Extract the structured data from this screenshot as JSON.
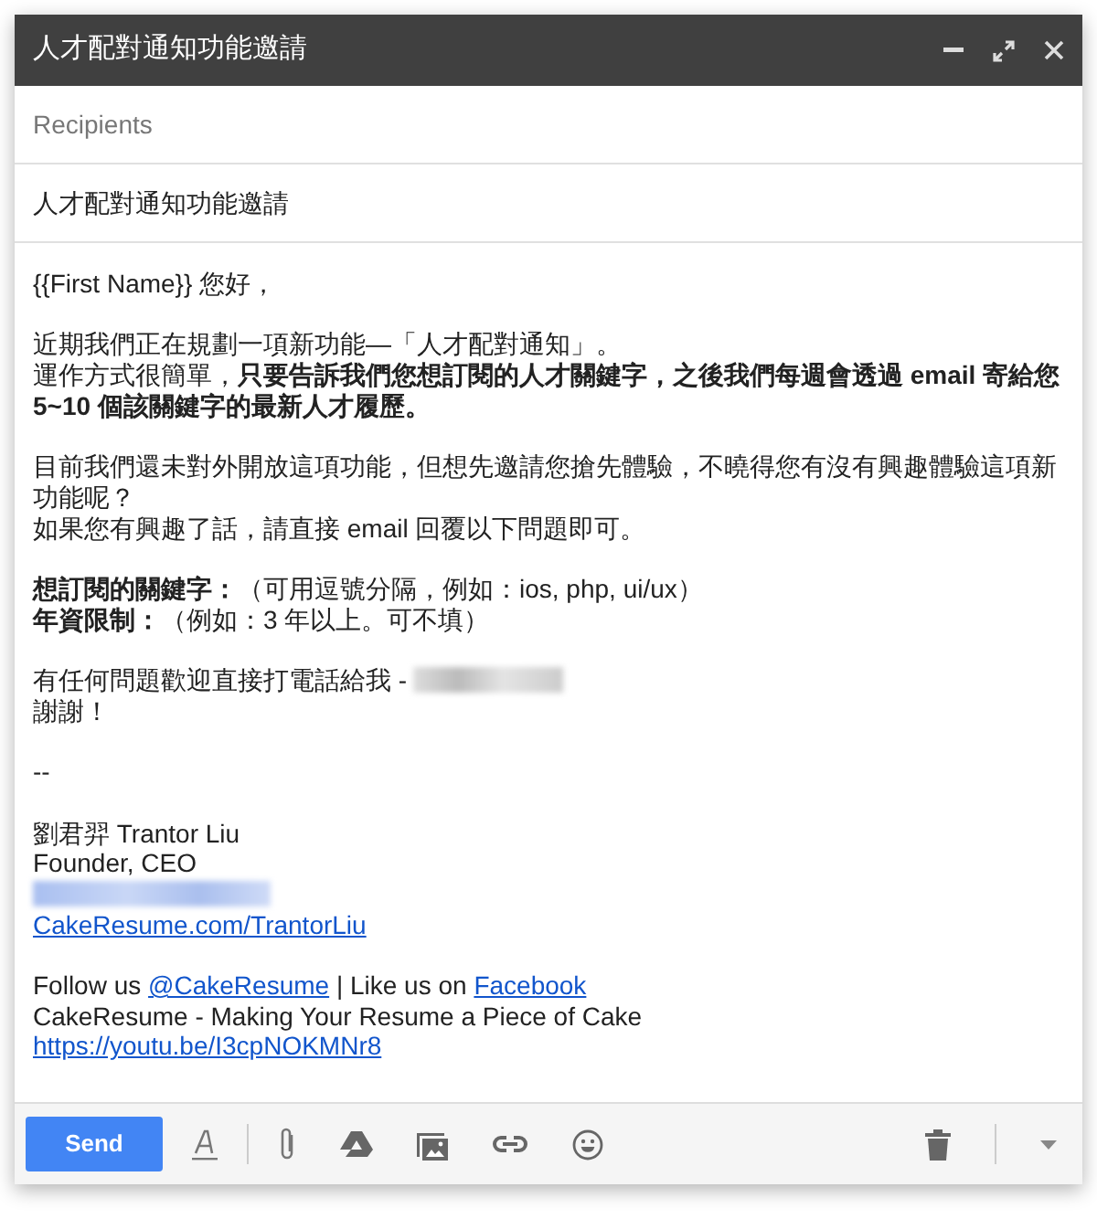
{
  "window": {
    "title": "人才配對通知功能邀請"
  },
  "recipients": {
    "placeholder": "Recipients"
  },
  "subject": {
    "value": "人才配對通知功能邀請"
  },
  "body": {
    "paragraphs": [
      {
        "lines": [
          [
            {
              "kind": "text",
              "text": "{{First Name}} 您好，"
            }
          ]
        ]
      },
      {
        "lines": [
          [
            {
              "kind": "text",
              "text": "近期我們正在規劃一項新功能—「人才配對通知」。"
            }
          ],
          [
            {
              "kind": "text",
              "text": "運作方式很簡單，**只要告訴我們您想訂閱的人才關鍵字，之後我們每週會透過 email 寄給您 5~10 個該關鍵字的最新人才履歷。**"
            }
          ]
        ]
      },
      {
        "lines": [
          [
            {
              "kind": "text",
              "text": "目前我們還未對外開放這項功能，但想先邀請您搶先體驗，不曉得您有沒有興趣體驗這項新功能呢？"
            }
          ],
          [
            {
              "kind": "text",
              "text": "如果您有興趣了話，請直接 email 回覆以下問題即可。"
            }
          ]
        ]
      },
      {
        "lines": [
          [
            {
              "kind": "text",
              "text": "**想訂閱的關鍵字：**（可用逗號分隔，例如：ios, php, ui/ux）"
            }
          ],
          [
            {
              "kind": "text",
              "text": "**年資限制：**（例如：3 年以上。可不填）"
            }
          ]
        ]
      },
      {
        "lines": [
          [
            {
              "kind": "text",
              "text": "有任何問題歡迎直接打電話給我 -"
            },
            {
              "kind": "redacted"
            }
          ],
          [
            {
              "kind": "text",
              "text": "謝謝！"
            }
          ]
        ]
      },
      {
        "lines": [
          [
            {
              "kind": "text",
              "text": "--"
            }
          ]
        ]
      },
      {
        "lines": [
          [
            {
              "kind": "text",
              "text": "劉君羿 Trantor Liu"
            }
          ],
          [
            {
              "kind": "text",
              "text": "Founder, CEO"
            }
          ],
          [
            {
              "kind": "redacted"
            }
          ],
          [
            {
              "kind": "link",
              "text": "CakeResume.com/TrantorLiu"
            }
          ]
        ]
      },
      {
        "lines": [
          [
            {
              "kind": "text",
              "text": "Follow us"
            },
            {
              "kind": "link",
              "text": "@CakeResume"
            },
            {
              "kind": "text",
              "text": "| Like us on"
            },
            {
              "kind": "link",
              "text": "Facebook"
            }
          ],
          [
            {
              "kind": "text",
              "text": "CakeResume - Making Your Resume a Piece of Cake"
            }
          ],
          [
            {
              "kind": "link",
              "text": "https://youtu.be/I3cpNOKMNr8"
            }
          ]
        ]
      }
    ]
  },
  "toolbar": {
    "send": "Send"
  }
}
